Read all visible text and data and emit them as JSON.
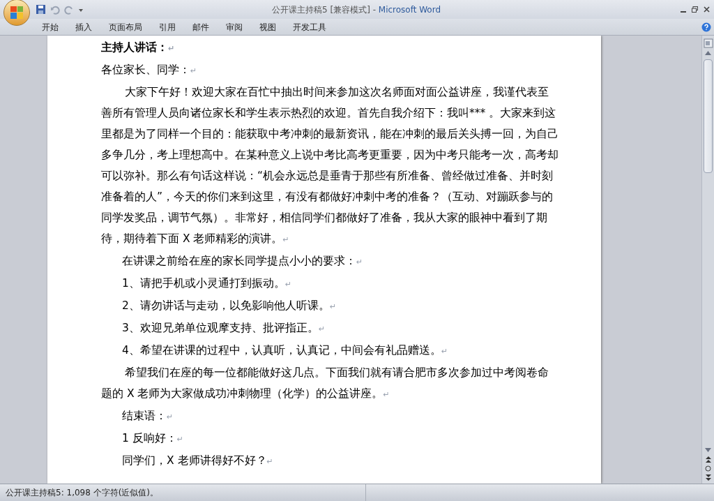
{
  "window": {
    "title": "公开课主持稿5 [兼容模式]",
    "separator": " - ",
    "app_name": "Microsoft Word"
  },
  "tabs": [
    {
      "label": "开始",
      "selected": false
    },
    {
      "label": "插入",
      "selected": false
    },
    {
      "label": "页面布局",
      "selected": false
    },
    {
      "label": "引用",
      "selected": false
    },
    {
      "label": "邮件",
      "selected": false
    },
    {
      "label": "审阅",
      "selected": false
    },
    {
      "label": "视图",
      "selected": false
    },
    {
      "label": "开发工具",
      "selected": false
    }
  ],
  "document": {
    "paragraphs": [
      {
        "kind": "heading",
        "text": "主持人讲话：",
        "mark": "↵"
      },
      {
        "kind": "plain",
        "text": "各位家长、同学：",
        "mark": "↵"
      },
      {
        "kind": "indent",
        "text": "大家下午好！欢迎大家在百忙中抽出时间来参加这次名师面对面公益讲座，我谨代表至善所有管理人员向诸位家长和学生表示热烈的欢迎。首先自我介绍下：我叫*** 。大家来到这里都是为了同样一个目的：能获取中考冲刺的最新资讯，能在冲刺的最后关头搏一回，为自己多争几分，考上理想高中。在某种意义上说中考比高考更重要，因为中考只能考一次，高考却可以弥补。那么有句话这样说：“机会永远总是垂青于那些有所准备、曾经做过准备、并时刻准备着的人”，今天的你们来到这里，有没有都做好冲刺中考的准备？（互动、对蹦跃参与的同学发奖品，调节气氛）。非常好，相信同学们都做好了准备，我从大家的眼神中看到了期待，期待着下面 X 老师精彩的演讲。",
        "mark": "↵"
      },
      {
        "kind": "item",
        "text": "在讲课之前给在座的家长同学提点小小的要求：",
        "mark": "↵"
      },
      {
        "kind": "item",
        "text": "1、请把手机或小灵通打到振动。",
        "mark": "↵"
      },
      {
        "kind": "item",
        "text": "2、请勿讲话与走动，以免影响他人听课。",
        "mark": "↵"
      },
      {
        "kind": "item",
        "text": "3、欢迎兄弟单位观摩支持、批评指正。",
        "mark": "↵"
      },
      {
        "kind": "item",
        "text": "4、希望在讲课的过程中，认真听，认真记，中间会有礼品赠送。",
        "mark": "↵"
      },
      {
        "kind": "indent",
        "text": "希望我们在座的每一位都能做好这几点。下面我们就有请合肥市多次参加过中考阅卷命题的 X 老师为大家做成功冲刺物理（化学）的公益讲座。",
        "mark": "↵"
      },
      {
        "kind": "item",
        "text": "结束语：",
        "mark": "↵"
      },
      {
        "kind": "item",
        "text": "1 反响好：",
        "mark": "↵"
      },
      {
        "kind": "item",
        "text": "同学们，X 老师讲得好不好？",
        "mark": "↵"
      }
    ]
  },
  "status_bar": {
    "text": "公开课主持稿5: 1,098 个字符(近似值)。"
  }
}
